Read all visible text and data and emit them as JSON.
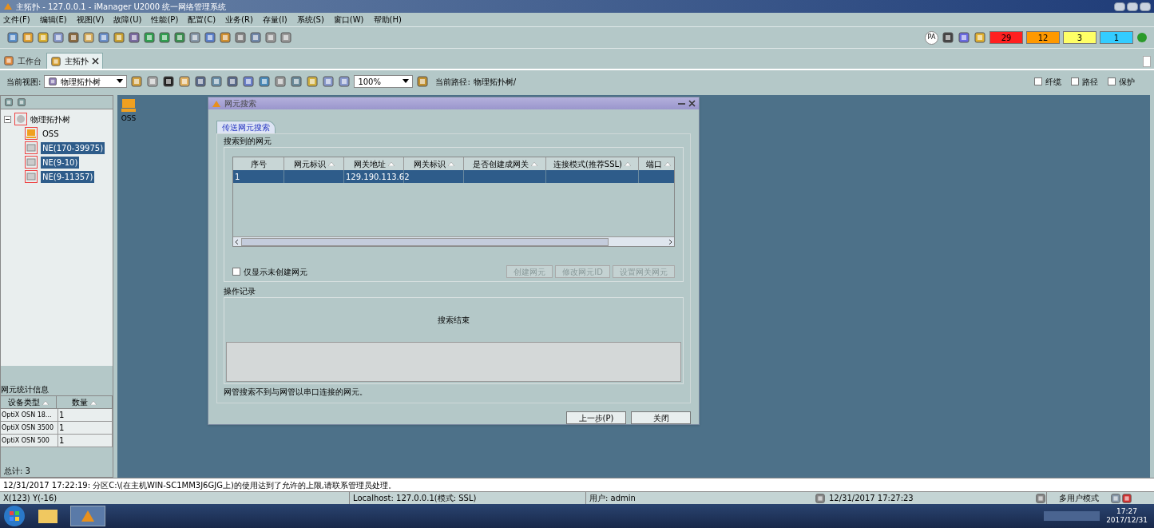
{
  "window": {
    "title": "主拓扑 - 127.0.0.1 - iManager U2000 统一网络管理系统"
  },
  "menu": [
    "文件(F)",
    "编辑(E)",
    "视图(V)",
    "故障(U)",
    "性能(P)",
    "配置(C)",
    "业务(R)",
    "存量(I)",
    "系统(S)",
    "窗口(W)",
    "帮助(H)"
  ],
  "pa_label": "PA",
  "alarms": [
    {
      "count": "29",
      "color": "#ff2020"
    },
    {
      "count": "12",
      "color": "#ff9900"
    },
    {
      "count": "3",
      "color": "#ffff66"
    },
    {
      "count": "1",
      "color": "#33ccff"
    }
  ],
  "tabs": [
    {
      "label": "工作台",
      "selected": false,
      "closable": false
    },
    {
      "label": "主拓扑",
      "selected": true,
      "closable": true
    }
  ],
  "view_bar": {
    "view_label": "当前视图:",
    "view_value": "物理拓扑树",
    "zoom": "100%",
    "path_label": "当前路径:",
    "path_value": "物理拓扑树/",
    "checkboxes": [
      {
        "label": "纤缆",
        "checked": false
      },
      {
        "label": "路径",
        "checked": false
      },
      {
        "label": "保护",
        "checked": false
      }
    ]
  },
  "tree": {
    "label": "物理拓扑树",
    "expanded": true,
    "children": [
      {
        "label": "OSS",
        "kind": "oss",
        "selected": false
      },
      {
        "label": "NE(170-39975)",
        "kind": "ne",
        "selected": true
      },
      {
        "label": "NE(9-10)",
        "kind": "ne",
        "selected": true
      },
      {
        "label": "NE(9-11357)",
        "kind": "ne",
        "selected": true
      }
    ]
  },
  "stats": {
    "title": "网元统计信息",
    "columns": [
      "设备类型",
      "数量"
    ],
    "rows": [
      [
        "OptiX OSN 18...",
        "1"
      ],
      [
        "OptiX OSN 3500",
        "1"
      ],
      [
        "OptiX OSN 500",
        "1"
      ]
    ],
    "total": "总计: 3"
  },
  "canvas": {
    "nodes": [
      {
        "label": "OSS"
      }
    ]
  },
  "dialog": {
    "title": "网元搜索",
    "tab": "传送网元搜索",
    "found_group": "搜索到的网元",
    "columns": [
      "序号",
      "网元标识",
      "网关地址",
      "网关标识",
      "是否创建成网关",
      "连接模式(推荐SSL)",
      "端口"
    ],
    "rows": [
      {
        "cells": [
          "1",
          "",
          "129.190.113.62",
          "",
          "",
          "",
          ""
        ],
        "selected": true
      }
    ],
    "filter": {
      "label": "仅显示未创建网元",
      "checked": false
    },
    "actions": [
      {
        "label": "创建网元",
        "disabled": true
      },
      {
        "label": "修改网元ID",
        "disabled": true
      },
      {
        "label": "设置网关网元",
        "disabled": true
      }
    ],
    "log_group": "操作记录",
    "log_message": "搜索结束",
    "note": "网管搜索不到与网管以串口连接的网元。",
    "footer": [
      {
        "label": "上一步(P)",
        "disabled": false
      },
      {
        "label": "关闭",
        "disabled": false
      }
    ]
  },
  "message": "12/31/2017 17:22:19: 分区C:\\(在主机WIN-SC1MM3J6GJG上)的使用达到了允许的上限,请联系管理员处理。",
  "status": {
    "coords": "X(123)  Y(-16)",
    "host": "Localhost: 127.0.0.1(模式: SSL)",
    "user": "用户: admin",
    "datetime": "12/31/2017 17:27:23",
    "mode": "多用户模式"
  },
  "taskbar": {
    "time": "17:27",
    "date": "2017/12/31"
  }
}
